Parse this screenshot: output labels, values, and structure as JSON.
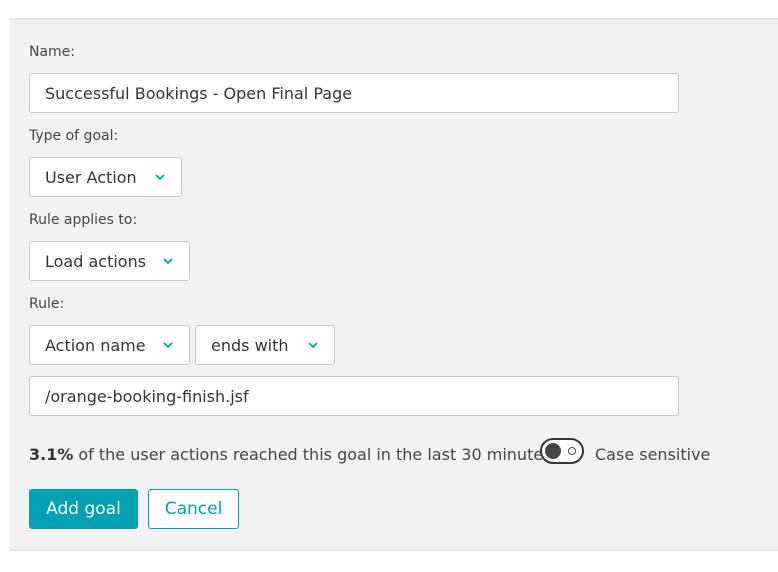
{
  "form": {
    "name_label": "Name:",
    "name_value": "Successful Bookings - Open Final Page",
    "goal_type_label": "Type of goal:",
    "goal_type_value": "User Action",
    "applies_label": "Rule applies to:",
    "applies_value": "Load actions",
    "rule_label": "Rule:",
    "rule_field_value": "Action name",
    "rule_operator_value": "ends with",
    "rule_pattern_value": "/orange-booking-finish.jsf",
    "stat_percent": "3.1%",
    "stat_text": "of the user actions reached this goal in the last 30 minutes.",
    "case_sensitive_label": "Case sensitive",
    "case_sensitive_on": false
  },
  "buttons": {
    "add_label": "Add goal",
    "cancel_label": "Cancel"
  },
  "colors": {
    "accent": "#00a1b2",
    "panel_bg": "#f2f2f2"
  },
  "icons": {
    "dropdown": "chevron-down-icon"
  }
}
